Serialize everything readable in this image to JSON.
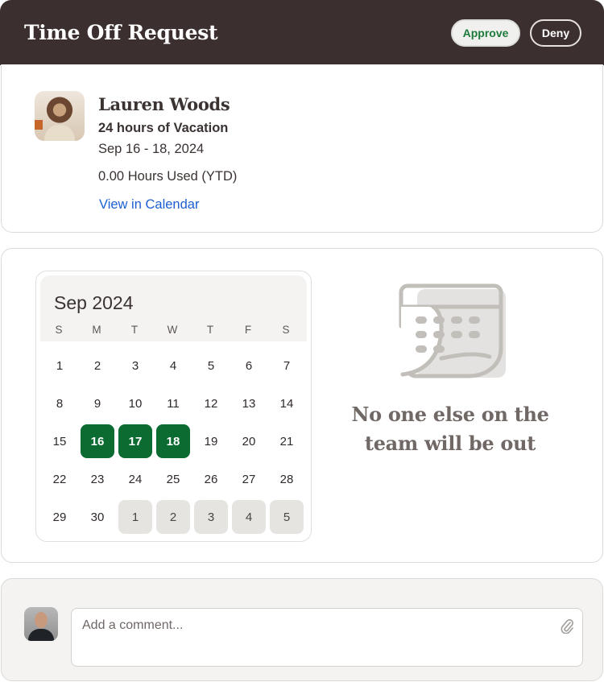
{
  "header": {
    "title": "Time Off Request",
    "approve_label": "Approve",
    "deny_label": "Deny"
  },
  "request": {
    "avatar_icon": "employee-photo",
    "name": "Lauren Woods",
    "summary": "24 hours of Vacation",
    "dates": "Sep 16 - 18, 2024",
    "hours_used": "0.00 Hours Used (YTD)",
    "calendar_link": "View in Calendar"
  },
  "calendar": {
    "month_label": "Sep 2024",
    "weekdays": [
      "S",
      "M",
      "T",
      "W",
      "T",
      "F",
      "S"
    ],
    "weeks": [
      [
        {
          "d": "1",
          "s": ""
        },
        {
          "d": "2",
          "s": ""
        },
        {
          "d": "3",
          "s": ""
        },
        {
          "d": "4",
          "s": ""
        },
        {
          "d": "5",
          "s": ""
        },
        {
          "d": "6",
          "s": ""
        },
        {
          "d": "7",
          "s": ""
        }
      ],
      [
        {
          "d": "8",
          "s": ""
        },
        {
          "d": "9",
          "s": ""
        },
        {
          "d": "10",
          "s": ""
        },
        {
          "d": "11",
          "s": ""
        },
        {
          "d": "12",
          "s": ""
        },
        {
          "d": "13",
          "s": ""
        },
        {
          "d": "14",
          "s": ""
        }
      ],
      [
        {
          "d": "15",
          "s": ""
        },
        {
          "d": "16",
          "s": "selected"
        },
        {
          "d": "17",
          "s": "selected"
        },
        {
          "d": "18",
          "s": "selected"
        },
        {
          "d": "19",
          "s": ""
        },
        {
          "d": "20",
          "s": ""
        },
        {
          "d": "21",
          "s": ""
        }
      ],
      [
        {
          "d": "22",
          "s": ""
        },
        {
          "d": "23",
          "s": ""
        },
        {
          "d": "24",
          "s": ""
        },
        {
          "d": "25",
          "s": ""
        },
        {
          "d": "26",
          "s": ""
        },
        {
          "d": "27",
          "s": ""
        },
        {
          "d": "28",
          "s": ""
        }
      ],
      [
        {
          "d": "29",
          "s": ""
        },
        {
          "d": "30",
          "s": ""
        },
        {
          "d": "1",
          "s": "next-month"
        },
        {
          "d": "2",
          "s": "next-month"
        },
        {
          "d": "3",
          "s": "next-month"
        },
        {
          "d": "4",
          "s": "next-month"
        },
        {
          "d": "5",
          "s": "next-month"
        }
      ]
    ],
    "selected_color": "#0b6b30"
  },
  "team_status": {
    "icon": "calendar-page-icon",
    "message": "No one else on the team will be out"
  },
  "comment": {
    "avatar_icon": "current-user-photo",
    "placeholder": "Add a comment...",
    "value": "",
    "attach_icon": "paperclip-icon"
  },
  "colors": {
    "header_bg": "#3b302f",
    "approve_text": "#1d7a3a",
    "link": "#1d5fd1"
  }
}
